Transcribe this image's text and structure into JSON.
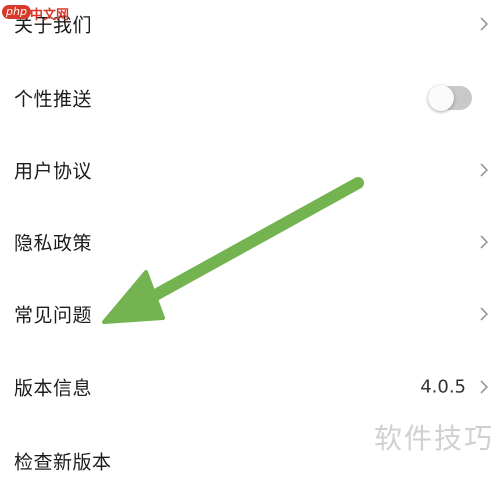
{
  "settings": {
    "items": [
      {
        "label": "关于我们"
      },
      {
        "label": "个性推送"
      },
      {
        "label": "用户协议"
      },
      {
        "label": "隐私政策"
      },
      {
        "label": "常见问题"
      },
      {
        "label": "版本信息",
        "value": "4.0.5"
      },
      {
        "label": "检查新版本"
      }
    ],
    "push_toggle_on": false
  },
  "logo": {
    "php": "php",
    "cn": "中文网"
  },
  "watermark": "软件技巧",
  "colors": {
    "arrow": "#74b450",
    "logo": "#d9392b",
    "toggle_off": "#c9c9c9"
  },
  "icons": [
    "chevron-right-icon",
    "toggle-switch",
    "annotation-arrow"
  ]
}
